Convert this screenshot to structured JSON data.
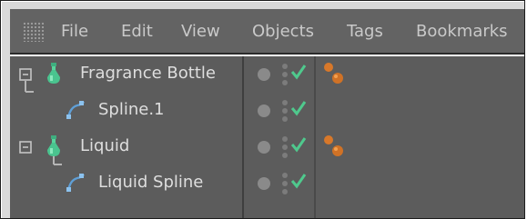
{
  "menu": {
    "items": [
      {
        "key": "file",
        "label": "File"
      },
      {
        "key": "edit",
        "label": "Edit"
      },
      {
        "key": "view",
        "label": "View"
      },
      {
        "key": "objects",
        "label": "Objects"
      },
      {
        "key": "tags",
        "label": "Tags"
      },
      {
        "key": "bookmarks",
        "label": "Bookmarks"
      }
    ]
  },
  "objects": [
    {
      "name": "Fragrance Bottle",
      "icon": "bottle-icon",
      "level": 0,
      "expanded": true,
      "has_tag": true,
      "enabled": true
    },
    {
      "name": "Spline.1",
      "icon": "spline-icon",
      "level": 1,
      "expanded": false,
      "has_tag": false,
      "enabled": true
    },
    {
      "name": "Liquid",
      "icon": "bottle-icon",
      "level": 0,
      "expanded": true,
      "has_tag": true,
      "enabled": true
    },
    {
      "name": "Liquid Spline",
      "icon": "spline-icon",
      "level": 1,
      "expanded": false,
      "has_tag": false,
      "enabled": true
    }
  ],
  "colors": {
    "menubar_bg": "#636363",
    "panel_bg": "#5c5c5c",
    "text": "#dedede",
    "check": "#4fc98d",
    "tag": "#d8782a",
    "bottle": "#4ac48f",
    "spline": "#5f9fd6"
  }
}
